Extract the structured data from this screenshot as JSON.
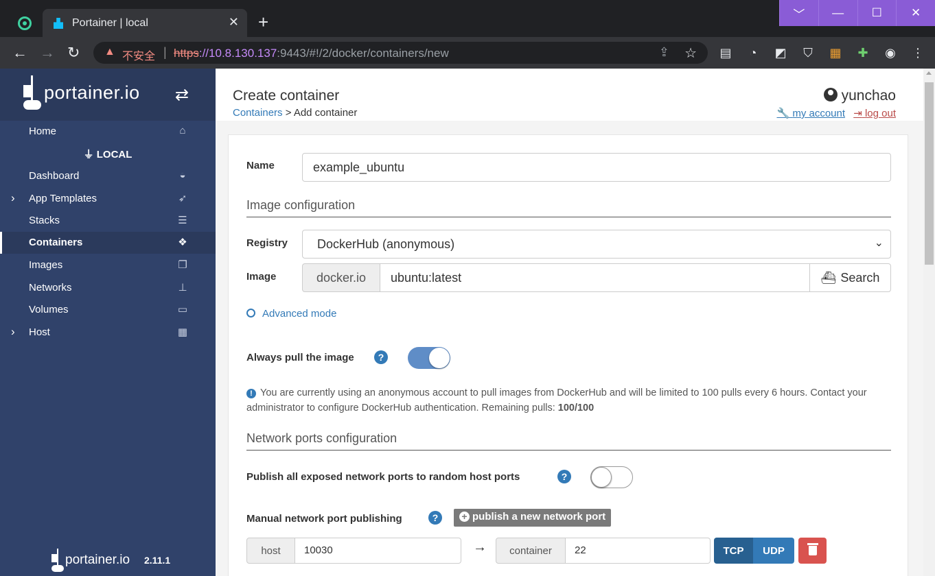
{
  "browser": {
    "tab_title": "Portainer | local",
    "tab_close": "✕",
    "new_tab": "+",
    "insecure_label": "不安全",
    "url_scheme": "https",
    "url_host": "://10.8.130.137",
    "url_rest": ":9443/#!/2/docker/containers/new",
    "window_controls": [
      "﹀",
      "—",
      "☐",
      "✕"
    ]
  },
  "sidebar": {
    "logo_text": "portainer.io",
    "endpoint": "LOCAL",
    "items": [
      {
        "label": "Home",
        "icon": "home-icon"
      },
      {
        "label": "Dashboard",
        "icon": "tachometer-icon"
      },
      {
        "label": "App Templates",
        "icon": "rocket-icon"
      },
      {
        "label": "Stacks",
        "icon": "list-icon"
      },
      {
        "label": "Containers",
        "icon": "cubes-icon"
      },
      {
        "label": "Images",
        "icon": "clone-icon"
      },
      {
        "label": "Networks",
        "icon": "sitemap-icon"
      },
      {
        "label": "Volumes",
        "icon": "hdd-icon"
      },
      {
        "label": "Host",
        "icon": "th-icon"
      }
    ],
    "footer_logo": "portainer.io",
    "version": "2.11.1"
  },
  "header": {
    "title": "Create container",
    "breadcrumb_link": "Containers",
    "breadcrumb_current": " > Add container",
    "username": "yunchao",
    "my_account": "my account",
    "log_out": "log out"
  },
  "form": {
    "name_label": "Name",
    "name_value": "example_ubuntu",
    "image_section": "Image configuration",
    "registry_label": "Registry",
    "registry_value": "DockerHub (anonymous)",
    "image_label": "Image",
    "image_prefix": "docker.io",
    "image_value": "ubuntu:latest",
    "search_button": "Search",
    "advanced_mode": "Advanced mode",
    "always_pull_label": "Always pull the image",
    "always_pull_on": true,
    "info_text": "You are currently using an anonymous account to pull images from DockerHub and will be limited to 100 pulls every 6 hours. Contact your administrator to configure DockerHub authentication. Remaining pulls: ",
    "remaining_pulls": "100/100",
    "network_section": "Network ports configuration",
    "publish_all_label": "Publish all exposed network ports to random host ports",
    "publish_all_on": false,
    "manual_label": "Manual network port publishing",
    "publish_button": "publish a new network port",
    "host_label": "host",
    "host_value": "10030",
    "container_label": "container",
    "container_value": "22",
    "tcp_label": "TCP",
    "udp_label": "UDP"
  },
  "colors": {
    "sidebar_bg": "#30426a",
    "primary": "#337ab7",
    "tcp_active": "#286090",
    "danger": "#d9534f"
  }
}
